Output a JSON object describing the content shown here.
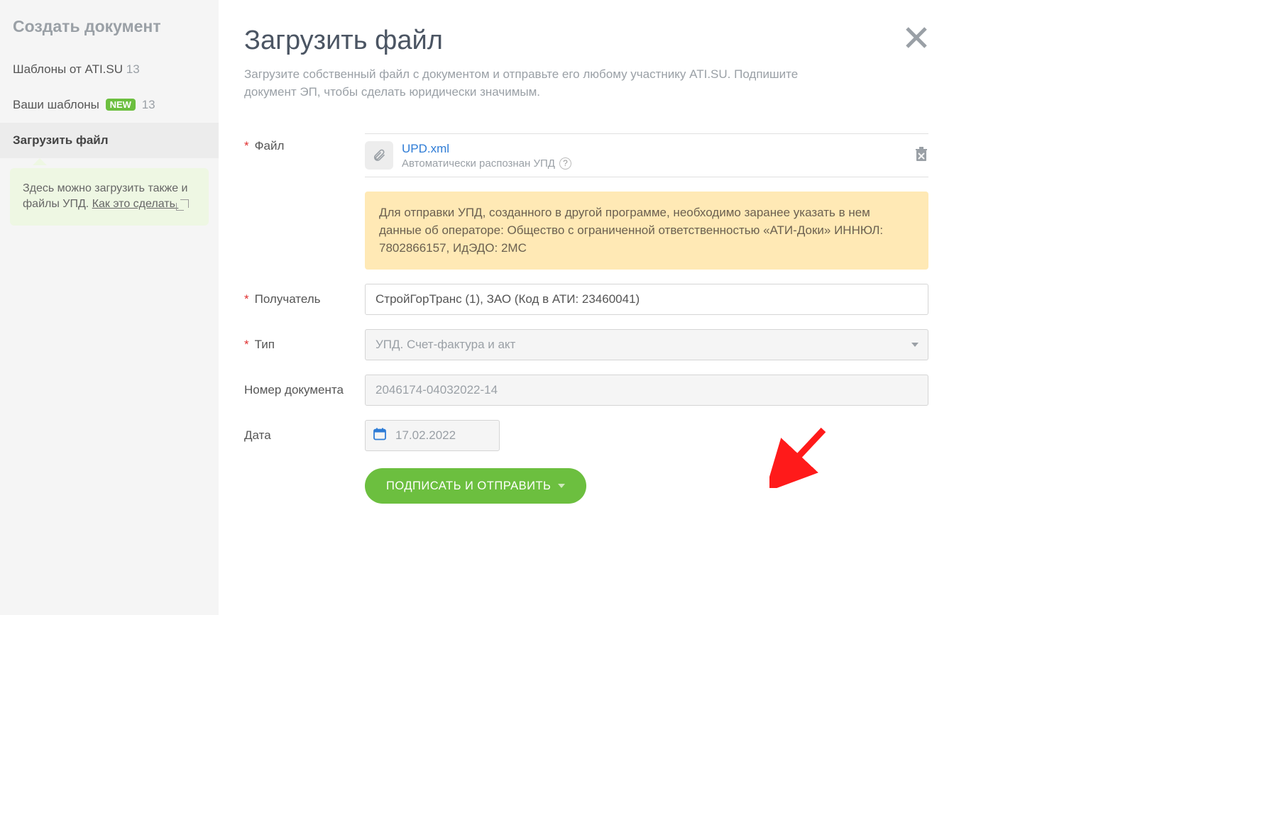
{
  "sidebar": {
    "title": "Создать документ",
    "items": [
      {
        "label": "Шаблоны от ATI.SU",
        "count": "13",
        "new": false
      },
      {
        "label": "Ваши шаблоны",
        "count": "13",
        "new": true,
        "newLabel": "NEW"
      },
      {
        "label": "Загрузить файл",
        "count": ""
      }
    ],
    "info_text": "Здесь можно загрузить также и файлы УПД.",
    "info_link": "Как это сделать"
  },
  "main": {
    "title": "Загрузить файл",
    "subtitle": "Загрузите собственный файл с документом и отправьте его любому участнику ATI.SU. Подпишите документ ЭП, чтобы сделать юридически значимым.",
    "labels": {
      "file": "Файл",
      "recipient": "Получатель",
      "type": "Тип",
      "docnum": "Номер документа",
      "date": "Дата"
    },
    "file": {
      "name": "UPD.xml",
      "sub": "Автоматически распознан УПД"
    },
    "note": "Для отправки УПД, созданного в другой программе, необходимо заранее указать в нем данные об операторе: Общество с ограниченной ответственностью «АТИ-Доки» ИННЮЛ: 7802866157, ИдЭДО: 2MC",
    "recipient_value": "СтройГорТранс (1), ЗАО (Код в АТИ: 23460041)",
    "type_value": "УПД. Счет-фактура и акт",
    "docnum_value": "2046174-04032022-14",
    "date_value": "17.02.2022",
    "submit_label": "ПОДПИСАТЬ И ОТПРАВИТЬ"
  }
}
